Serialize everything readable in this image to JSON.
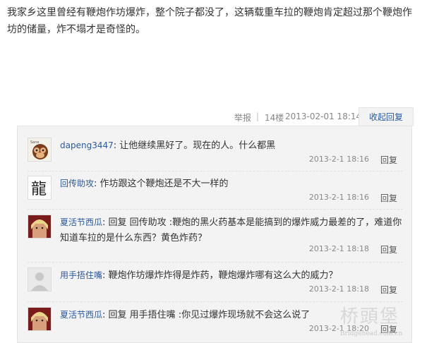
{
  "post": {
    "text": "我家乡这里曾经有鞭炮作坊爆炸，整个院子都没了，这辆载重车拉的鞭炮肯定超过那个鞭炮作坊的储量，炸不塌才是奇怪的。"
  },
  "meta": {
    "report": "举报",
    "separator": "|",
    "floor": "14楼",
    "time": "2013-02-01 18:14",
    "collapse": "收起回复"
  },
  "replies": [
    {
      "user": "dapeng3447",
      "colon": ":",
      "text": "让他继续黑好了。现在的人。什么都黑",
      "time": "2013-2-1 18:16",
      "reply": "回复",
      "avatar_icon": "monkey-avatar-icon"
    },
    {
      "user": "回传助攻",
      "colon": ":",
      "text": "作坊跟这个鞭炮还是不大一样的",
      "time": "2013-2-1 18:16",
      "reply": "回复",
      "avatar_icon": "dragon-calligraphy-avatar-icon"
    },
    {
      "user": "夏活节西瓜",
      "colon": ":",
      "text": "回复 回传助攻 :鞭炮的黑火药基本是能搞到的爆炸威力最差的了，难道你知道车拉的是什么东西？黄色炸药？",
      "time": "2013-2-1 18:18",
      "reply": "回复",
      "avatar_icon": "anime-character-avatar-icon"
    },
    {
      "user": "用手捂住嘴",
      "colon": ":",
      "text": "鞭炮作坊爆炸炸得是炸药，鞭炮爆炸哪有这么大的威力？",
      "time": "2013-2-1 18:18",
      "reply": "回复",
      "avatar_icon": "default-user-avatar-icon"
    },
    {
      "user": "夏活节西瓜",
      "colon": ":",
      "text": "回复 用手捂住嘴 :你见过爆炸现场就不会这么说了",
      "time": "2013-2-1 18:20",
      "reply": "回复",
      "avatar_icon": "anime-character-avatar-icon"
    }
  ],
  "watermark": {
    "cn": "桥頭堡",
    "en": "Bridgehead.com.cn"
  }
}
